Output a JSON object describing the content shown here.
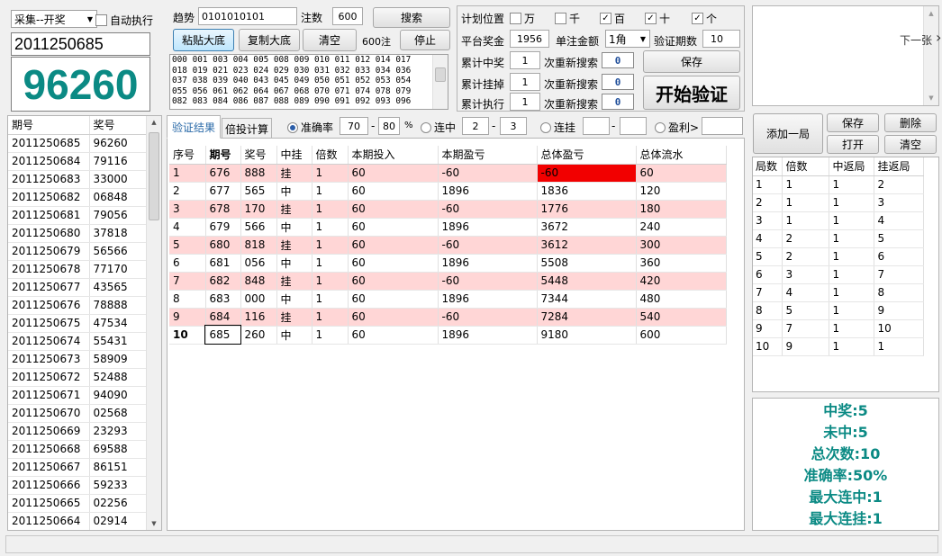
{
  "top_left": {
    "mode": "采集--开奖",
    "auto_exec": "自动执行",
    "period": "2011250685",
    "number": "96260"
  },
  "search": {
    "trend_label": "趋势",
    "trend_value": "0101010101",
    "bets_label": "注数",
    "bets_value": "600",
    "search_btn": "搜索",
    "paste_btn": "粘贴大底",
    "copy_btn": "复制大底",
    "clear_btn": "清空",
    "count_label": "600注",
    "stop_btn": "停止",
    "numbers": [
      "000 001 003 004 005 008 009 010 011 012 014 017",
      "018 019 021 023 024 029 030 031 032 033 034 036",
      "037 038 039 040 043 045 049 050 051 052 053 054",
      "055 056 061 062 064 067 068 070 071 074 078 079",
      "082 083 084 086 087 088 089 090 091 092 093 096"
    ]
  },
  "plan": {
    "pos_label": "计划位置",
    "positions": [
      {
        "label": "万",
        "checked": ""
      },
      {
        "label": "千",
        "checked": ""
      },
      {
        "label": "百",
        "checked": "✓"
      },
      {
        "label": "十",
        "checked": "✓"
      },
      {
        "label": "个",
        "checked": "✓"
      }
    ],
    "prize_label": "平台奖金",
    "prize_value": "1956",
    "amount_label": "单注金额",
    "amount_value": "1角",
    "verify_label": "验证期数",
    "verify_value": "10",
    "hit_label": "累计中奖",
    "hit_value": "1",
    "miss_label": "累计挂掉",
    "miss_value": "1",
    "exec_label": "累计执行",
    "exec_value": "1",
    "research_label": "次重新搜索",
    "r1": "0",
    "r2": "0",
    "r3": "0",
    "save_btn": "保存",
    "start_btn": "开始验证"
  },
  "side": {
    "next": "下一张",
    "arrow": "›",
    "add": "添加一局",
    "save": "保存",
    "del": "删除",
    "open": "打开",
    "clear": "清空",
    "headers": [
      "局数",
      "倍数",
      "中返局",
      "挂返局"
    ],
    "rows": [
      [
        "1",
        "1",
        "1",
        "2"
      ],
      [
        "2",
        "1",
        "1",
        "3"
      ],
      [
        "3",
        "1",
        "1",
        "4"
      ],
      [
        "4",
        "2",
        "1",
        "5"
      ],
      [
        "5",
        "2",
        "1",
        "6"
      ],
      [
        "6",
        "3",
        "1",
        "7"
      ],
      [
        "7",
        "4",
        "1",
        "8"
      ],
      [
        "8",
        "5",
        "1",
        "9"
      ],
      [
        "9",
        "7",
        "1",
        "10"
      ],
      [
        "10",
        "9",
        "1",
        "1"
      ]
    ]
  },
  "history": {
    "headers": [
      "期号",
      "奖号"
    ],
    "rows": [
      [
        "2011250685",
        "96260"
      ],
      [
        "2011250684",
        "79116"
      ],
      [
        "2011250683",
        "33000"
      ],
      [
        "2011250682",
        "06848"
      ],
      [
        "2011250681",
        "79056"
      ],
      [
        "2011250680",
        "37818"
      ],
      [
        "2011250679",
        "56566"
      ],
      [
        "2011250678",
        "77170"
      ],
      [
        "2011250677",
        "43565"
      ],
      [
        "2011250676",
        "78888"
      ],
      [
        "2011250675",
        "47534"
      ],
      [
        "2011250674",
        "55431"
      ],
      [
        "2011250673",
        "58909"
      ],
      [
        "2011250672",
        "52488"
      ],
      [
        "2011250671",
        "94090"
      ],
      [
        "2011250670",
        "02568"
      ],
      [
        "2011250669",
        "23293"
      ],
      [
        "2011250668",
        "69588"
      ],
      [
        "2011250667",
        "86151"
      ],
      [
        "2011250666",
        "59233"
      ],
      [
        "2011250665",
        "02256"
      ],
      [
        "2011250664",
        "02914"
      ]
    ]
  },
  "tabs": {
    "t1": "验证结果",
    "t2": "倍投计算"
  },
  "filter": {
    "acc": "准确率",
    "acc_from": "70",
    "dash": "-",
    "acc_to": "80",
    "pct": "%",
    "streak_hit": "连中",
    "sh_from": "2",
    "sh_to": "3",
    "streak_miss": "连挂",
    "profit": "盈利>"
  },
  "results": {
    "headers": [
      "序号",
      "期号",
      "奖号",
      "中挂",
      "倍数",
      "本期投入",
      "本期盈亏",
      "总体盈亏",
      "总体流水"
    ],
    "rows": [
      [
        "1",
        "676",
        "888",
        "挂",
        "1",
        "60",
        "-60",
        "-60",
        "60"
      ],
      [
        "2",
        "677",
        "565",
        "中",
        "1",
        "60",
        "1896",
        "1836",
        "120"
      ],
      [
        "3",
        "678",
        "170",
        "挂",
        "1",
        "60",
        "-60",
        "1776",
        "180"
      ],
      [
        "4",
        "679",
        "566",
        "中",
        "1",
        "60",
        "1896",
        "3672",
        "240"
      ],
      [
        "5",
        "680",
        "818",
        "挂",
        "1",
        "60",
        "-60",
        "3612",
        "300"
      ],
      [
        "6",
        "681",
        "056",
        "中",
        "1",
        "60",
        "1896",
        "5508",
        "360"
      ],
      [
        "7",
        "682",
        "848",
        "挂",
        "1",
        "60",
        "-60",
        "5448",
        "420"
      ],
      [
        "8",
        "683",
        "000",
        "中",
        "1",
        "60",
        "1896",
        "7344",
        "480"
      ],
      [
        "9",
        "684",
        "116",
        "挂",
        "1",
        "60",
        "-60",
        "7284",
        "540"
      ],
      [
        "10",
        "685",
        "260",
        "中",
        "1",
        "60",
        "1896",
        "9180",
        "600"
      ]
    ]
  },
  "stats": {
    "win": "中奖:5",
    "lose": "未中:5",
    "total": "总次数:10",
    "rate": "准确率:50%",
    "max_hit": "最大连中:1",
    "max_miss": "最大连挂:1"
  },
  "colors": {
    "teal": "#0b8a84",
    "loss_row": "#ffd6d6",
    "loss_cell": "#f20000"
  }
}
